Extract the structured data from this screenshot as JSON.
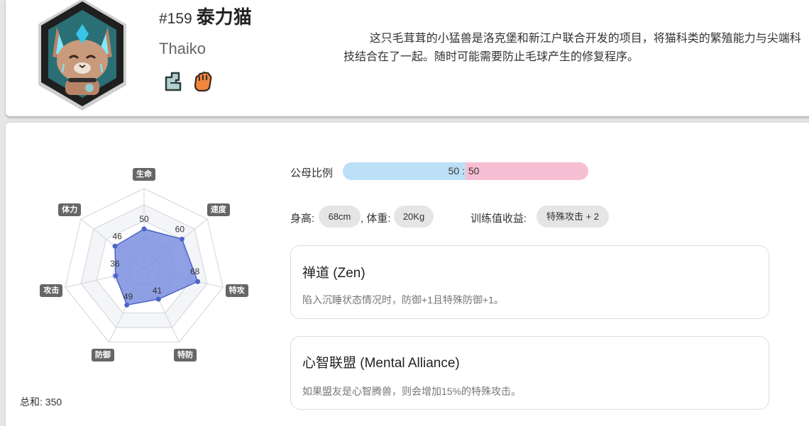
{
  "header": {
    "number": "#159",
    "name": "泰力猫",
    "english_name": "Thaiko",
    "types": [
      {
        "icon": "earth-fist-type-icon",
        "color": "#b4cfcf"
      },
      {
        "icon": "fire-fist-type-icon",
        "color": "#f0873d"
      }
    ],
    "description": "这只毛茸茸的小猛兽是洛克堡和新江户联合开发的项目，将猫科类的繁殖能力与尖端科技结合在了一起。随时可能需要防止毛球产生的修复程序。"
  },
  "stats": {
    "labels": [
      "生命",
      "速度",
      "特攻",
      "特防",
      "防御",
      "攻击",
      "体力"
    ],
    "values": [
      50,
      60,
      68,
      41,
      49,
      36,
      46
    ],
    "value_text": [
      "50",
      "60",
      "68",
      "41",
      "49",
      "36",
      "46"
    ],
    "max": 100,
    "total_label": "总和: 350",
    "fill_color": "#7b8fe0",
    "point_color": "#4c65c7"
  },
  "info": {
    "gender_label": "公母比例",
    "male": "50",
    "separator": ":",
    "female": "50",
    "height_label": "身高:",
    "height": "68cm",
    "weight_label": ", 体重:",
    "weight": "20Kg",
    "ev_label": "训练值收益:",
    "ev": "特殊攻击 + 2"
  },
  "abilities": [
    {
      "name": "禅道 (Zen)",
      "description": "陷入沉睡状态情况时，防御+1且特殊防御+1。"
    },
    {
      "name": "心智联盟 (Mental Alliance)",
      "description": "如果盟友是心智腾兽，则会增加15%的特殊攻击。"
    }
  ],
  "colors": {
    "male_bar": "#bcdff8",
    "female_bar": "#f7bfd3"
  }
}
